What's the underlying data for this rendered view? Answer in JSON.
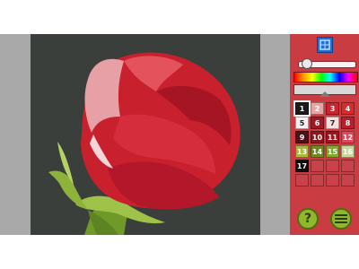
{
  "colors": {
    "panel_bg": "#c93c42",
    "canvas_bg": "#3a3f3b",
    "accent_blue": "#1e6fd6",
    "button_green": "#8fb82a"
  },
  "toolbar": {
    "tool_icon": "grid-view-icon"
  },
  "brush": {
    "size_fraction": 0.08
  },
  "palette": {
    "cells": [
      {
        "label": "1",
        "color": "#1a1a1a",
        "text_color": "#ffffff",
        "selected": true
      },
      {
        "label": "2",
        "color": "#e8a4a4",
        "text_color": "#ffffff"
      },
      {
        "label": "3",
        "color": "#c9252f",
        "text_color": "#ffffff"
      },
      {
        "label": "4",
        "color": "#d62c2c",
        "text_color": "#ffffff"
      },
      {
        "label": "5",
        "color": "#f2f2f2",
        "text_color": "#222222"
      },
      {
        "label": "6",
        "color": "#9c1b25",
        "text_color": "#ffffff"
      },
      {
        "label": "7",
        "color": "#f5dede",
        "text_color": "#222222"
      },
      {
        "label": "8",
        "color": "#b81e2b",
        "text_color": "#ffffff"
      },
      {
        "label": "9",
        "color": "#4a1216",
        "text_color": "#ffffff"
      },
      {
        "label": "10",
        "color": "#8e1621",
        "text_color": "#ffffff"
      },
      {
        "label": "11",
        "color": "#a0121f",
        "text_color": "#ffffff"
      },
      {
        "label": "12",
        "color": "#e0475a",
        "text_color": "#ffffff"
      },
      {
        "label": "13",
        "color": "#a7b83c",
        "text_color": "#ffffff"
      },
      {
        "label": "14",
        "color": "#6f8a23",
        "text_color": "#ffffff"
      },
      {
        "label": "15",
        "color": "#7ea92a",
        "text_color": "#ffffff"
      },
      {
        "label": "16",
        "color": "#c9d79a",
        "text_color": "#ffffff"
      },
      {
        "label": "17",
        "color": "#0d0d0d",
        "text_color": "#ffffff"
      },
      {
        "label": "",
        "color": "#c7424a",
        "text_color": "#ffffff"
      },
      {
        "label": "",
        "color": "#c7424a",
        "text_color": "#ffffff"
      },
      {
        "label": "",
        "color": "#c7424a",
        "text_color": "#ffffff"
      },
      {
        "label": "",
        "color": "#c7424a",
        "text_color": "#ffffff"
      },
      {
        "label": "",
        "color": "#c7424a",
        "text_color": "#ffffff"
      },
      {
        "label": "",
        "color": "#c7424a",
        "text_color": "#ffffff"
      },
      {
        "label": "",
        "color": "#c7424a",
        "text_color": "#ffffff"
      }
    ]
  },
  "bottom_buttons": {
    "hint_label": "?",
    "menu_icon": "hamburger-menu-icon"
  }
}
